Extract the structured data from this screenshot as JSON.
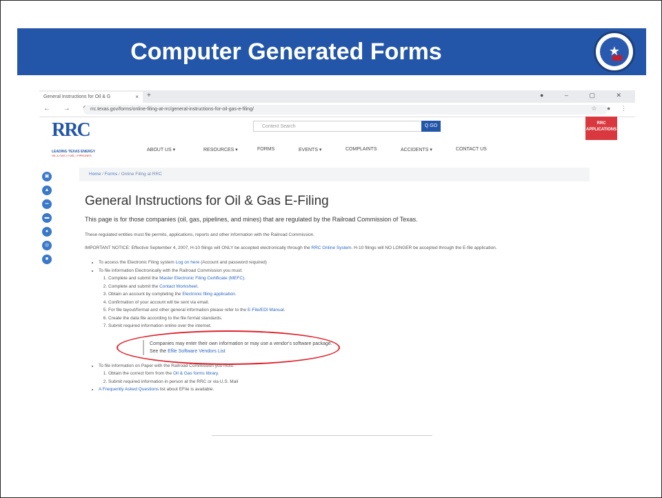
{
  "slide": {
    "title": "Computer Generated Forms"
  },
  "browser": {
    "tab_title": "General Instructions for Oil & G",
    "tab_close": "×",
    "tab_new": "+",
    "window_controls": "● – ▢ ✕",
    "nav_buttons": "← → C ⌂",
    "url": "rrc.texas.gov/forms/online-filing-at-rrc/general-instructions-for-oil-gas-e-filing/",
    "url_icons": "☆ ● ⋮"
  },
  "site": {
    "logo_text": "RRC",
    "logo_tagline": "LEADING TEXAS ENERGY",
    "logo_subline": "OIL & GAS • FUEL • PIPELINES",
    "search_placeholder": "Content Search",
    "go_label": "Q GO",
    "apps_label": "RRC APPLICATIONS",
    "menu": [
      {
        "label": "ABOUT US ▾"
      },
      {
        "label": "RESOURCES ▾"
      },
      {
        "label": "FORMS"
      },
      {
        "label": "EVENTS ▾"
      },
      {
        "label": "COMPLAINTS"
      },
      {
        "label": "ACCIDENTS ▾"
      },
      {
        "label": "CONTACT US"
      }
    ]
  },
  "breadcrumb": {
    "home": "Home",
    "forms": "Forms",
    "current": "Online Filing at RRC",
    "sep": "/"
  },
  "page": {
    "heading": "General Instructions for Oil & Gas E-Filing",
    "lead": "This page is for those companies (oil, gas, pipelines, and mines) that are regulated by the Railroad Commission of Texas.",
    "para1": "These regulated entities must file permits, applications, reports and other information with the Railroad Commission.",
    "notice_pre": "IMPORTANT NOTICE: Effective September 4, 2007, H-10 filings will ONLY be accepted electronically through the ",
    "notice_link": "RRC Online System",
    "notice_post": ". H-10 filings will NO LONGER be accepted through the E-file application.",
    "bullet1_pre": "To access the Electronic Filing system ",
    "bullet1_link": "Log on here",
    "bullet1_post": " (Account and password required)",
    "bullet2": "To file information Electronically with the Railroad Commission you must:",
    "steps": {
      "s1_pre": "Complete and submit the ",
      "s1_link": "Master Electronic Filing Certificate (MEFC)",
      "s1_post": ".",
      "s2_pre": "Complete and submit the ",
      "s2_link": "Contact Worksheet",
      "s2_post": ".",
      "s3_pre": "Obtain an account by completing the ",
      "s3_link": "Electronic filing application",
      "s3_post": ".",
      "s4": "Confirmation of your account will be sent via email.",
      "s5_pre": "For file layout/format and other general information please refer to the ",
      "s5_link": "E-File/EDI Manual",
      "s5_post": ".",
      "s6": "Create the data file according to the file format standards.",
      "s7": "Submit required information online over the internet."
    },
    "callout_line1": "Companies may enter their own information or may use a vendor's software package.",
    "callout_pre": "See the ",
    "callout_link": "Efile Software Vendors List",
    "bullet3": "To file information on Paper with the Railroad Commission you must:",
    "paper": {
      "p1_pre": "Obtain the correct form from the ",
      "p1_link": "Oil & Gas forms library",
      "p1_post": ".",
      "p2": "Submit required information in person at the RRC or via U.S. Mail"
    },
    "bullet4_link": "A Frequently Asked Questions",
    "bullet4_post": " list about EFile is available."
  },
  "colors": {
    "banner": "#2356a8",
    "highlight": "#e0202a",
    "link": "#2a66c0"
  }
}
